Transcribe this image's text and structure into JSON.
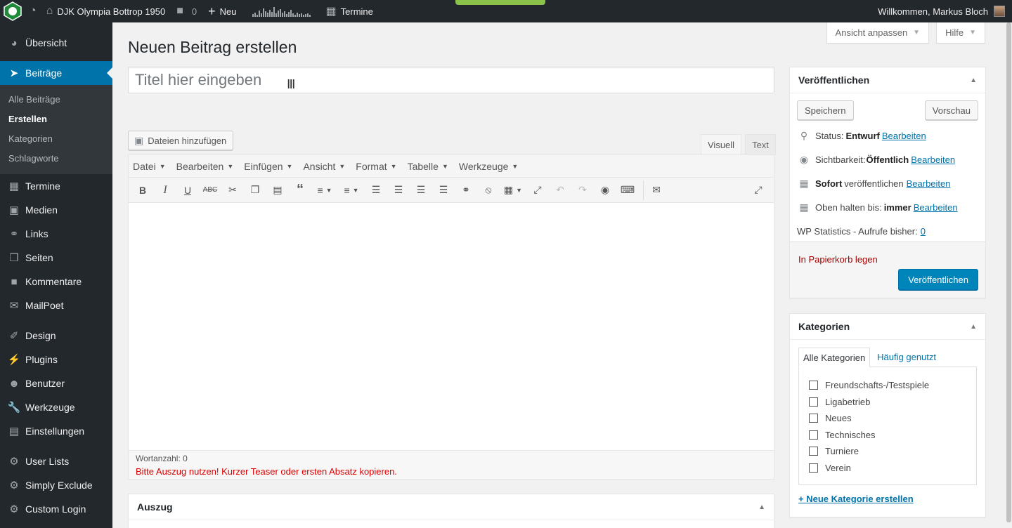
{
  "adminbar": {
    "site_name": "DJK Olympia Bottrop 1950",
    "comments_count": "0",
    "new_label": "Neu",
    "termine_label": "Termine",
    "welcome": "Willkommen, Markus Bloch"
  },
  "sidebar": {
    "items": [
      {
        "label": "Übersicht",
        "icon": "dashboard-icon"
      },
      {
        "label": "Beiträge",
        "icon": "pin-icon",
        "current": true
      },
      {
        "label": "Termine",
        "icon": "calendar-icon"
      },
      {
        "label": "Medien",
        "icon": "media-icon"
      },
      {
        "label": "Links",
        "icon": "link-icon"
      },
      {
        "label": "Seiten",
        "icon": "pages-icon"
      },
      {
        "label": "Kommentare",
        "icon": "comment-icon"
      },
      {
        "label": "MailPoet",
        "icon": "mail-icon"
      },
      {
        "label": "Design",
        "icon": "brush-icon"
      },
      {
        "label": "Plugins",
        "icon": "plugin-icon"
      },
      {
        "label": "Benutzer",
        "icon": "user-icon"
      },
      {
        "label": "Werkzeuge",
        "icon": "wrench-icon"
      },
      {
        "label": "Einstellungen",
        "icon": "settings-icon"
      },
      {
        "label": "User Lists",
        "icon": "gear-icon"
      },
      {
        "label": "Simply Exclude",
        "icon": "gear-icon"
      },
      {
        "label": "Custom Login",
        "icon": "gear-icon"
      }
    ],
    "submenu": [
      {
        "label": "Alle Beiträge"
      },
      {
        "label": "Erstellen",
        "current": true
      },
      {
        "label": "Kategorien"
      },
      {
        "label": "Schlagworte"
      }
    ]
  },
  "screen": {
    "options_label": "Ansicht anpassen",
    "help_label": "Hilfe"
  },
  "page": {
    "title": "Neuen Beitrag erstellen",
    "title_placeholder": "Titel hier eingeben"
  },
  "editor": {
    "add_media": "Dateien hinzufügen",
    "tab_visual": "Visuell",
    "tab_text": "Text",
    "menus": [
      "Datei",
      "Bearbeiten",
      "Einfügen",
      "Ansicht",
      "Format",
      "Tabelle",
      "Werkzeuge"
    ],
    "word_count": "Wortanzahl: 0",
    "teaser_notice": "Bitte Auszug nutzen! Kurzer Teaser oder ersten Absatz kopieren."
  },
  "excerpt": {
    "title": "Auszug"
  },
  "publish": {
    "title": "Veröffentlichen",
    "save": "Speichern",
    "preview": "Vorschau",
    "status_label": "Status:",
    "status_value": "Entwurf",
    "visibility_label": "Sichtbarkeit:",
    "visibility_value": "Öffentlich",
    "publish_when": "Sofort",
    "publish_when_suffix": "veröffentlichen",
    "sticky_label": "Oben halten bis:",
    "sticky_value": "immer",
    "edit": "Bearbeiten",
    "stats_label": "WP Statistics - Aufrufe bisher:",
    "stats_value": "0",
    "trash": "In Papierkorb legen",
    "publish_button": "Veröffentlichen"
  },
  "categories": {
    "title": "Kategorien",
    "tab_all": "Alle Kategorien",
    "tab_popular": "Häufig genutzt",
    "items": [
      "Freundschafts-/Testspiele",
      "Ligabetrieb",
      "Neues",
      "Technisches",
      "Turniere",
      "Verein"
    ],
    "add_new": "+ Neue Kategorie erstellen"
  },
  "colors": {
    "accent": "#0073aa",
    "primary_button": "#0085ba",
    "sidebar_bg": "#23282d",
    "notice_red": "#dc0000"
  }
}
